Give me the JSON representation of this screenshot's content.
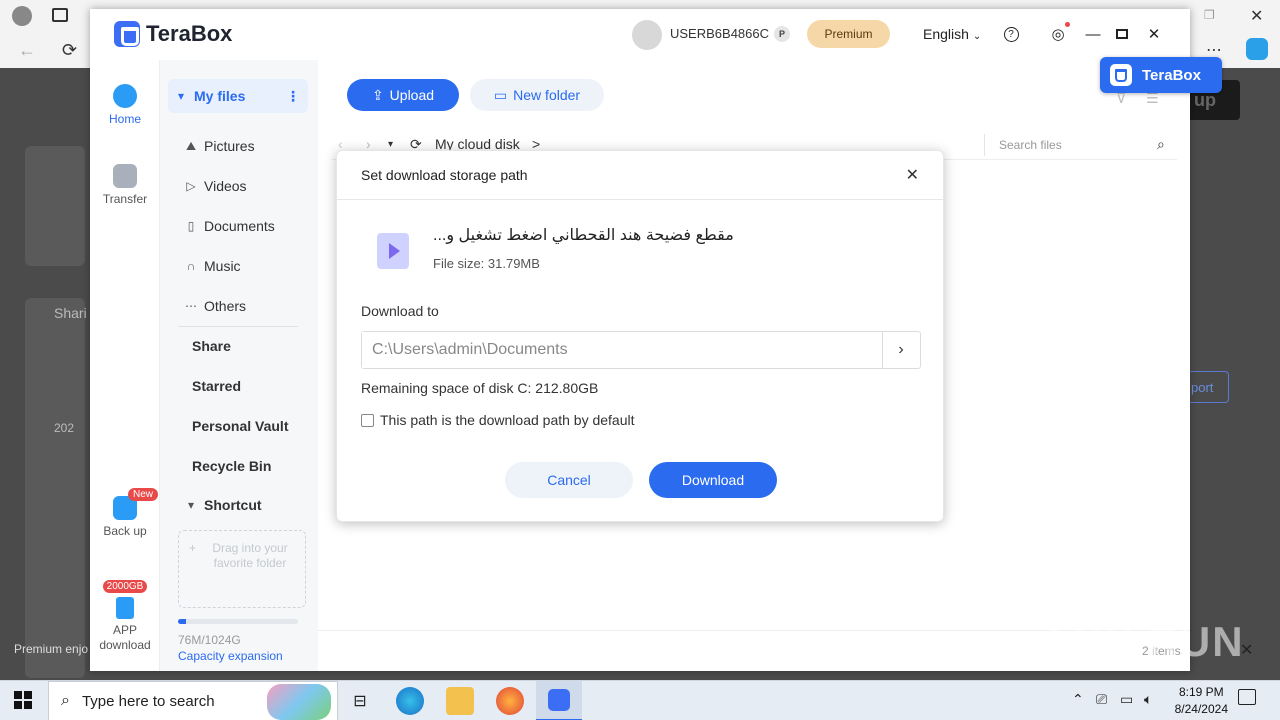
{
  "app": {
    "name": "TeraBox",
    "username": "USERB6B4866C",
    "premium_label": "Premium",
    "language": "English"
  },
  "rail": {
    "home": "Home",
    "transfer": "Transfer",
    "backup": "Back up",
    "new_badge": "New",
    "storage_badge": "2000GB",
    "app_download": "APP\ndownload"
  },
  "sidebar": {
    "my_files": "My files",
    "items": [
      "Pictures",
      "Videos",
      "Documents",
      "Music",
      "Others"
    ],
    "sections": [
      "Share",
      "Starred",
      "Personal Vault",
      "Recycle Bin"
    ],
    "shortcut": "Shortcut",
    "drop_hint": "Drag into your favorite folder",
    "capacity_text": "76M/1024G",
    "capacity_fraction": 0.07,
    "capacity_link": "Capacity expansion"
  },
  "toolbar": {
    "upload": "Upload",
    "new_folder": "New folder",
    "breadcrumb": "My cloud disk",
    "breadcrumb_sep": ">",
    "search_placeholder": "Search files",
    "items_count": "2 items"
  },
  "floating_badge": "TeraBox",
  "modal": {
    "title": "Set download storage path",
    "file_name": "مقطع فضيحة هند القحطاني اضغط تشغيل و...",
    "file_size": "File size: 31.79MB",
    "download_to": "Download to",
    "path": "C:\\Users\\admin\\Documents",
    "remaining": "Remaining space of disk C: 212.80GB",
    "default_path_label": "This path is the download path by default",
    "cancel": "Cancel",
    "download": "Download"
  },
  "background": {
    "text_share": "Shari",
    "text_premium": "Premium enjo",
    "text_up": "up",
    "text_port": "port",
    "text_year": "202"
  },
  "taskbar": {
    "search_placeholder": "Type here to search",
    "time": "8:19 PM",
    "date": "8/24/2024"
  },
  "watermark": "ANY RUN",
  "colors": {
    "accent": "#2a6bf0",
    "premium": "#f6d7a8",
    "badge_red": "#e84a4a"
  }
}
